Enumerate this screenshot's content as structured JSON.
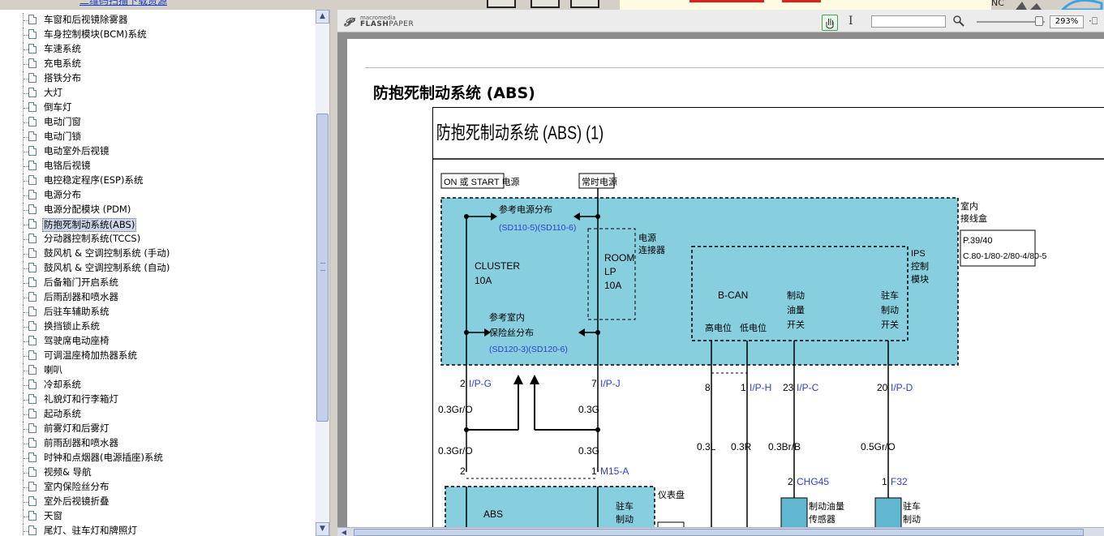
{
  "top_strip": {
    "link_text": "二维码扫描下载资源",
    "nc_label": "NC"
  },
  "tree": {
    "items": [
      {
        "label": "车窗和后视镜除雾器",
        "selected": false
      },
      {
        "label": "车身控制模块(BCM)系统",
        "selected": false
      },
      {
        "label": "车速系统",
        "selected": false
      },
      {
        "label": "充电系统",
        "selected": false
      },
      {
        "label": "搭铁分布",
        "selected": false
      },
      {
        "label": "大灯",
        "selected": false
      },
      {
        "label": "倒车灯",
        "selected": false
      },
      {
        "label": "电动门窗",
        "selected": false
      },
      {
        "label": "电动门锁",
        "selected": false
      },
      {
        "label": "电动室外后视镜",
        "selected": false
      },
      {
        "label": "电铬后视镜",
        "selected": false
      },
      {
        "label": "电控稳定程序(ESP)系统",
        "selected": false
      },
      {
        "label": "电源分布",
        "selected": false
      },
      {
        "label": "电源分配模块 (PDM)",
        "selected": false
      },
      {
        "label": "防抱死制动系统(ABS)",
        "selected": true
      },
      {
        "label": "分动器控制系统(TCCS)",
        "selected": false
      },
      {
        "label": "鼓风机 & 空调控制系统 (手动)",
        "selected": false
      },
      {
        "label": "鼓风机 & 空调控制系统 (自动)",
        "selected": false
      },
      {
        "label": "后备箱门开启系统",
        "selected": false
      },
      {
        "label": "后雨刮器和喷水器",
        "selected": false
      },
      {
        "label": "后驻车辅助系统",
        "selected": false
      },
      {
        "label": "换挡锁止系统",
        "selected": false
      },
      {
        "label": "驾驶席电动座椅",
        "selected": false
      },
      {
        "label": "可调温座椅加热器系统",
        "selected": false
      },
      {
        "label": "喇叭",
        "selected": false
      },
      {
        "label": "冷却系统",
        "selected": false
      },
      {
        "label": "礼貌灯和行李箱灯",
        "selected": false
      },
      {
        "label": "起动系统",
        "selected": false
      },
      {
        "label": "前雾灯和后雾灯",
        "selected": false
      },
      {
        "label": "前雨刮器和喷水器",
        "selected": false
      },
      {
        "label": "时钟和点烟器(电源插座)系统",
        "selected": false
      },
      {
        "label": "视频& 导航",
        "selected": false
      },
      {
        "label": "室内保险丝分布",
        "selected": false
      },
      {
        "label": "室外后视镜折叠",
        "selected": false
      },
      {
        "label": "天窗",
        "selected": false
      },
      {
        "label": "尾灯、驻车灯和牌照灯",
        "selected": false
      }
    ]
  },
  "viewer": {
    "brand_small": "macromedia",
    "brand_main_bold": "FLASH",
    "brand_main": "PAPER",
    "zoom": "293%",
    "search_value": ""
  },
  "page": {
    "heading": "防抱死制动系统 (ABS)"
  },
  "diagram": {
    "title": "防抱死制动系统 (ABS) (1)",
    "label_on_start": "ON 或 START 电源",
    "label_constant": "常时电源",
    "junction_box": "室内\n接线盒",
    "junction_ref_1": "P.39/40",
    "junction_ref_2": "C.80-1/80-2/80-4/80-5",
    "ref_power": "参考电源分布",
    "ref_power_codes": "(SD110-5)(SD110-6)",
    "cluster_fuse": "CLUSTER\n10A",
    "room_fuse": "ROOM\nLP\n10A",
    "power_connector": "电源\n连接器",
    "ref_fuse_1": "参考室内",
    "ref_fuse_2": "保险丝分布",
    "ref_fuse_codes": "(SD120-3)(SD120-6)",
    "ips_module": "IPS\n控制\n模块",
    "bcan": "B-CAN",
    "bcan_high": "高电位",
    "bcan_low": "低电位",
    "brake_fluid_switch": "制动\n油量\n开关",
    "parking_brake_switch": "驻车\n制动\n开关",
    "pin_2": "2",
    "conn_ipg": "I/P-G",
    "pin_7": "7",
    "conn_ipj": "I/P-J",
    "pin_8": "8",
    "pin_1": "1",
    "conn_iph": "I/P-H",
    "pin_23": "23",
    "conn_ipc": "I/P-C",
    "pin_20": "20",
    "conn_ipd": "I/P-D",
    "wire_03gro_a": "0.3Gr/O",
    "wire_03g_a": "0.3G",
    "wire_03gro_b": "0.3Gr/O",
    "wire_03g_b": "0.3G",
    "wire_03l": "0.3L",
    "wire_03r": "0.3R",
    "wire_03brb": "0.3Br/B",
    "wire_05gro": "0.5Gr/O",
    "pin_2b": "2",
    "pin_1b": "1",
    "conn_m15a": "M15-A",
    "cluster_label": "仪表盘",
    "abs_label": "ABS",
    "parking_label": "驻车\n制动",
    "pin_2c": "2",
    "conn_chg45": "CHG45",
    "pin_1c": "1",
    "conn_f32": "F32",
    "fluid_sensor": "制动油量\n传感器",
    "parking_switch_bottom": "驻车\n制动"
  },
  "colors": {
    "diagram_fill": "#87cedf",
    "connector_blue": "#2b3fd1",
    "sensor_fill": "#5fb8cf"
  }
}
